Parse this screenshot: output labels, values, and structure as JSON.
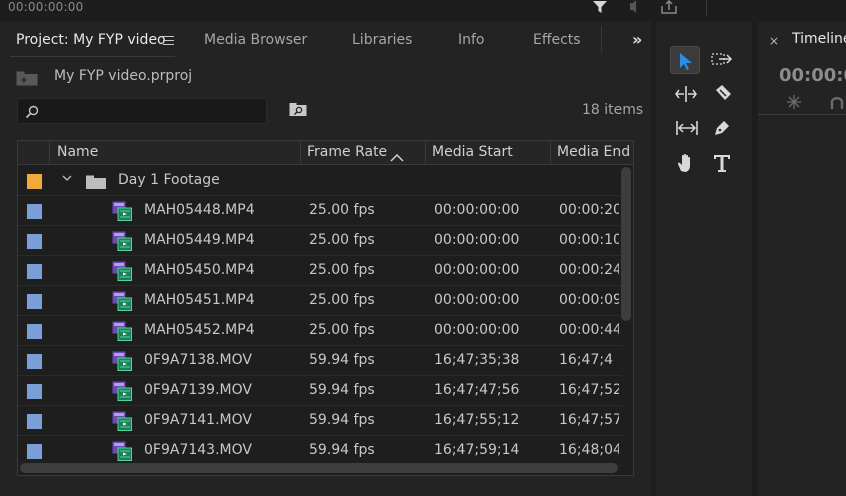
{
  "topbar": {
    "timecode": "00:00:00:00"
  },
  "project_panel": {
    "tabs": [
      {
        "label": "Project: My FYP video",
        "active": true
      },
      {
        "label": "Media Browser",
        "active": false
      },
      {
        "label": "Libraries",
        "active": false
      },
      {
        "label": "Info",
        "active": false
      },
      {
        "label": "Effects",
        "active": false
      }
    ],
    "overflow_label": "»",
    "path": "My FYP video.prproj",
    "search": {
      "value": "",
      "placeholder": ""
    },
    "item_count": "18 items",
    "columns": {
      "name": "Name",
      "frame_rate": "Frame Rate",
      "media_start": "Media Start",
      "media_end": "Media End"
    },
    "sort": {
      "column": "Frame Rate",
      "direction": "ascending"
    },
    "folder": {
      "name": "Day 1 Footage",
      "label_color": "#f0a93a",
      "expanded": true
    },
    "clip_label_color": "#7a9fd6",
    "clips": [
      {
        "name": "MAH05448.MP4",
        "frame_rate": "25.00 fps",
        "media_start": "00:00:00:00",
        "media_end": "00:00:20:"
      },
      {
        "name": "MAH05449.MP4",
        "frame_rate": "25.00 fps",
        "media_start": "00:00:00:00",
        "media_end": "00:00:10:"
      },
      {
        "name": "MAH05450.MP4",
        "frame_rate": "25.00 fps",
        "media_start": "00:00:00:00",
        "media_end": "00:00:24:"
      },
      {
        "name": "MAH05451.MP4",
        "frame_rate": "25.00 fps",
        "media_start": "00:00:00:00",
        "media_end": "00:00:09:"
      },
      {
        "name": "MAH05452.MP4",
        "frame_rate": "25.00 fps",
        "media_start": "00:00:00:00",
        "media_end": "00:00:44:"
      },
      {
        "name": "0F9A7138.MOV",
        "frame_rate": "59.94 fps",
        "media_start": "16;47;35;38",
        "media_end": "16;47;4"
      },
      {
        "name": "0F9A7139.MOV",
        "frame_rate": "59.94 fps",
        "media_start": "16;47;47;56",
        "media_end": "16;47;52"
      },
      {
        "name": "0F9A7141.MOV",
        "frame_rate": "59.94 fps",
        "media_start": "16;47;55;12",
        "media_end": "16;47;57"
      },
      {
        "name": "0F9A7143.MOV",
        "frame_rate": "59.94 fps",
        "media_start": "16;47;59;14",
        "media_end": "16;48;04"
      }
    ]
  },
  "tools_panel": {
    "tools": [
      "selection-tool",
      "track-select-forward-tool",
      "ripple-edit-tool",
      "razor-tool",
      "slip-tool",
      "pen-tool",
      "hand-tool",
      "type-tool"
    ],
    "selected": "selection-tool"
  },
  "timeline_panel": {
    "close_label": "×",
    "title": "Timeline",
    "timecode": "00:00:0"
  }
}
